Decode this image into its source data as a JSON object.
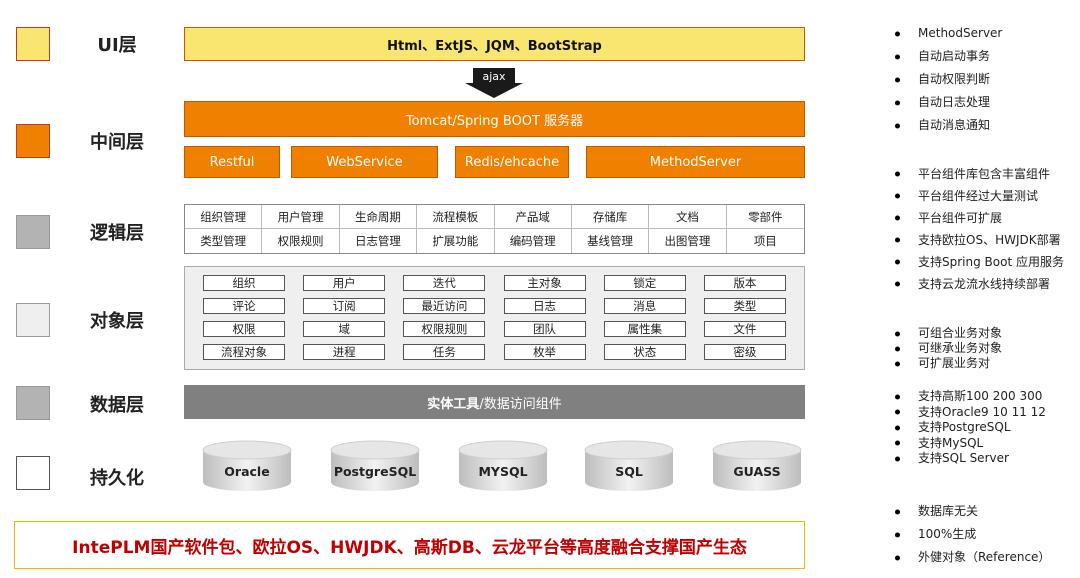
{
  "layers": [
    {
      "label": "UI层",
      "color": "#f8e671"
    },
    {
      "label": "中间层",
      "color": "#f08000"
    },
    {
      "label": "逻辑层",
      "color": "#b3b3b3"
    },
    {
      "label": "对象层",
      "color": "#efefef"
    },
    {
      "label": "数据层",
      "color": "#b3b3b3"
    },
    {
      "label": "持久化",
      "color": "#ffffff"
    }
  ],
  "ui_bar": "Html、ExtJS、JQM、BootStrap",
  "ajax": "ajax",
  "middle": {
    "server": "Tomcat/Spring BOOT 服务器",
    "components": [
      "Restful",
      "WebService",
      "Redis/ehcache",
      "MethodServer"
    ]
  },
  "logic": {
    "rows": [
      [
        "组织管理",
        "用户管理",
        "生命周期",
        "流程模板",
        "产品域",
        "存储库",
        "文档",
        "零部件"
      ],
      [
        "类型管理",
        "权限规则",
        "日志管理",
        "扩展功能",
        "编码管理",
        "基线管理",
        "出图管理",
        "项目"
      ]
    ]
  },
  "objects": {
    "rows": [
      [
        "组织",
        "用户",
        "迭代",
        "主对象",
        "锁定",
        "版本"
      ],
      [
        "评论",
        "订阅",
        "最近访问",
        "日志",
        "消息",
        "类型"
      ],
      [
        "权限",
        "域",
        "权限规则",
        "团队",
        "属性集",
        "文件"
      ],
      [
        "流程对象",
        "进程",
        "任务",
        "枚举",
        "状态",
        "密级"
      ]
    ]
  },
  "data_bar": {
    "bold": "实体工具",
    "rest": "/数据访问组件"
  },
  "databases": [
    "Oracle",
    "PostgreSQL",
    "MYSQL",
    "SQL",
    "GUASS"
  ],
  "footer": "IntePLM国产软件包、欧拉OS、HWJDK、高斯DB、云龙平台等高度融合支撑国产生态",
  "side_notes": [
    [
      "MethodServer",
      "自动启动事务",
      "自动权限判断",
      "自动日志处理",
      "自动消息通知"
    ],
    [
      "平台组件库包含丰富组件",
      "平台组件经过大量测试",
      "平台组件可扩展",
      "支持欧拉OS、HWJDK部署",
      "支持Spring Boot 应用服务",
      "支持云龙流水线持续部署"
    ],
    [
      "可组合业务对象",
      "可继承业务对象",
      "可扩展业务对"
    ],
    [
      "支持高斯100 200 300",
      "支持Oracle9 10 11 12",
      "支持PostgreSQL",
      "支持MySQL",
      "支持SQL Server"
    ],
    [
      "数据库无关",
      "100%生成",
      "外健对象（Reference）"
    ]
  ]
}
